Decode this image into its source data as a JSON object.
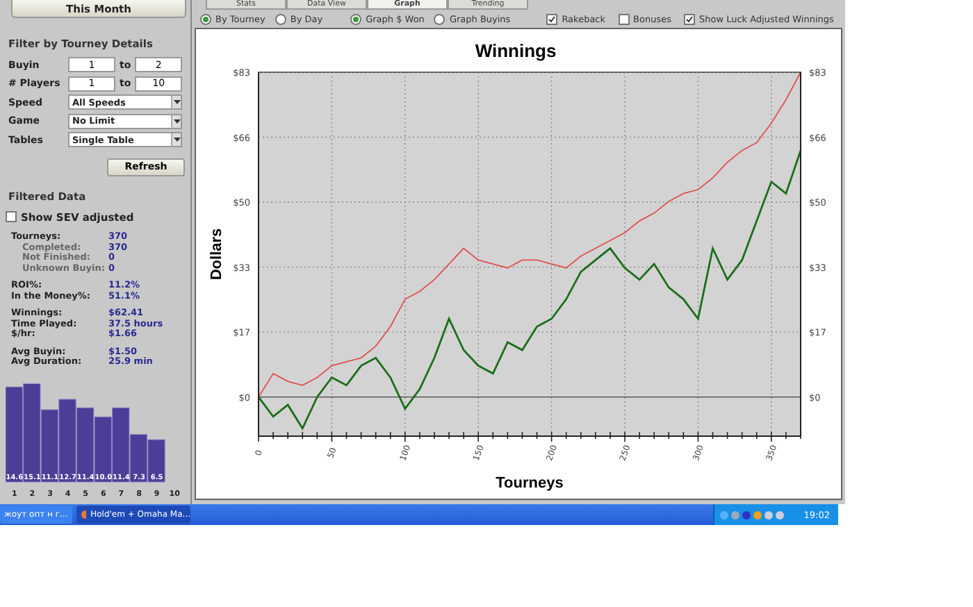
{
  "left_panel": {
    "period_button": "This Month",
    "filter": {
      "title": "Filter by Tourney Details",
      "ranges": [
        {
          "label": "Buyin",
          "from": "1",
          "to_label": "to",
          "to": "2"
        },
        {
          "label": "# Players",
          "from": "1",
          "to_label": "to",
          "to": "10"
        }
      ],
      "selects": [
        {
          "label": "Speed",
          "value": "All Speeds"
        },
        {
          "label": "Game",
          "value": "No Limit"
        },
        {
          "label": "Tables",
          "value": "Single Table"
        }
      ],
      "refresh_button": "Refresh"
    },
    "filtered": {
      "title": "Filtered Data",
      "sev_checkbox": {
        "label": "Show SEV adjusted",
        "checked": false
      },
      "stats": [
        [
          {
            "label": "Tourneys:",
            "value": "370",
            "kind": "main"
          },
          {
            "label": "Completed:",
            "value": "370",
            "kind": "sub"
          },
          {
            "label": "Not Finished:",
            "value": "0",
            "kind": "sub"
          },
          {
            "label": "Unknown Buyin:",
            "value": "0",
            "kind": "sub"
          }
        ],
        [
          {
            "label": "ROI%:",
            "value": "11.2%",
            "kind": "main"
          },
          {
            "label": "In the Money%:",
            "value": "51.1%",
            "kind": "main"
          }
        ],
        [
          {
            "label": "Winnings:",
            "value": "$62.41",
            "kind": "main"
          },
          {
            "label": "Time Played:",
            "value": "37.5 hours",
            "kind": "main"
          },
          {
            "label": "$/hr:",
            "value": "$1.66",
            "kind": "main"
          }
        ],
        [
          {
            "label": "Avg Buyin:",
            "value": "$1.50",
            "kind": "main"
          },
          {
            "label": "Avg Duration:",
            "value": "25.9 min",
            "kind": "main"
          }
        ]
      ],
      "histogram": {
        "chart_data": {
          "type": "bar",
          "categories": [
            "1",
            "2",
            "3",
            "4",
            "5",
            "6",
            "7",
            "8",
            "9",
            "10"
          ],
          "values": [
            14.6,
            15.1,
            11.1,
            12.7,
            11.4,
            10.0,
            11.4,
            7.3,
            6.5,
            null
          ],
          "value_labels": [
            "14.6",
            "15.1",
            "11.1",
            "12.7",
            "11.4",
            "10.0",
            "11.4",
            "7.3",
            "6.5",
            null
          ],
          "data_labels": true
        }
      }
    }
  },
  "tabs": [
    {
      "label": "Stats",
      "selected": false
    },
    {
      "label": "Data View",
      "selected": false
    },
    {
      "label": "Graph",
      "selected": true
    },
    {
      "label": "Trending",
      "selected": false
    }
  ],
  "options": {
    "x_mode": [
      {
        "label": "By Tourney",
        "selected": true
      },
      {
        "label": "By Day",
        "selected": false
      }
    ],
    "y_mode": [
      {
        "label": "Graph $ Won",
        "selected": true
      },
      {
        "label": "Graph Buyins",
        "selected": false
      }
    ],
    "checkboxes": [
      {
        "label": "Rakeback",
        "checked": true
      },
      {
        "label": "Bonuses",
        "checked": false
      },
      {
        "label": "Show Luck Adjusted Winnings",
        "checked": true
      }
    ]
  },
  "graph": {
    "chart_data": {
      "type": "line",
      "title": "Winnings",
      "xlabel": "Tourneys",
      "ylabel": "Dollars",
      "x": [
        0,
        10,
        20,
        30,
        40,
        50,
        60,
        70,
        80,
        90,
        100,
        110,
        120,
        130,
        140,
        150,
        160,
        170,
        180,
        190,
        200,
        210,
        220,
        230,
        240,
        250,
        260,
        270,
        280,
        290,
        300,
        310,
        320,
        330,
        340,
        350,
        360,
        370
      ],
      "series": [
        {
          "color": "#e05050",
          "values": [
            0,
            6,
            4,
            3,
            5,
            8,
            9,
            10,
            13,
            18,
            25,
            27,
            30,
            34,
            38,
            35,
            34,
            33,
            35,
            35,
            34,
            33,
            36,
            38,
            40,
            42,
            45,
            47,
            50,
            52,
            53,
            56,
            60,
            63,
            65,
            70,
            76,
            83
          ]
        },
        {
          "color": "#1a6e1a",
          "values": [
            0,
            -5,
            -2,
            -8,
            0,
            5,
            3,
            8,
            10,
            5,
            -3,
            2,
            10,
            20,
            12,
            8,
            6,
            14,
            12,
            18,
            20,
            25,
            32,
            35,
            38,
            33,
            30,
            34,
            28,
            25,
            20,
            38,
            30,
            35,
            45,
            55,
            52,
            63
          ]
        }
      ],
      "xlim": [
        0,
        370
      ],
      "ylim": [
        -10,
        83
      ],
      "y2lim": [
        -10,
        83
      ],
      "grid": true,
      "xticks": [
        0,
        50,
        100,
        150,
        200,
        250,
        300,
        350
      ],
      "yticks": [
        {
          "value": 0,
          "label": "$0"
        },
        {
          "value": 16.6,
          "label": "$17"
        },
        {
          "value": 33.2,
          "label": "$33"
        },
        {
          "value": 49.8,
          "label": "$50"
        },
        {
          "value": 66.4,
          "label": "$66"
        },
        {
          "value": 83,
          "label": "$83"
        }
      ],
      "y2ticks": [
        {
          "value": 0,
          "label": "$0"
        },
        {
          "value": 16.6,
          "label": "$17"
        },
        {
          "value": 33.2,
          "label": "$33"
        },
        {
          "value": 49.8,
          "label": "$50"
        },
        {
          "value": 66.4,
          "label": "$66"
        },
        {
          "value": 83,
          "label": "$83"
        }
      ]
    }
  },
  "taskbar": {
    "items": [
      {
        "label": "жоут опт н г...",
        "selected": false
      },
      {
        "label": "Hold'em + Omaha Ma...",
        "selected": true
      }
    ],
    "clock": "19:02"
  }
}
